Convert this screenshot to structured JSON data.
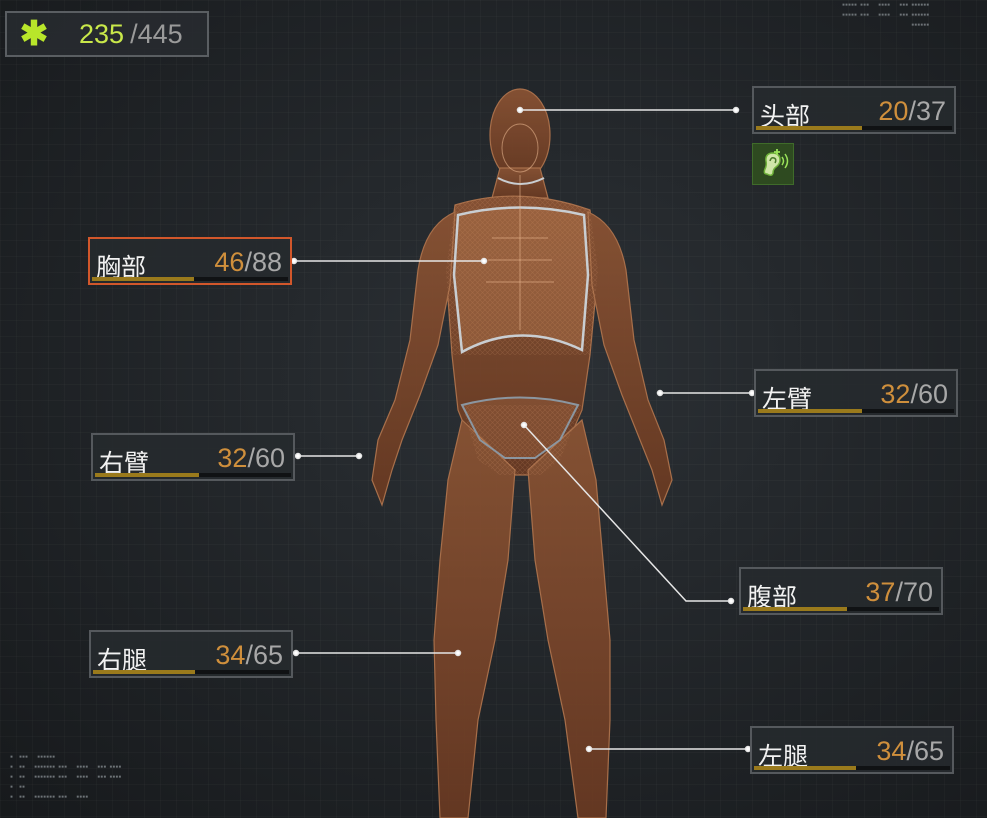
{
  "health_total": {
    "current": "235",
    "separator": " /",
    "max": "445",
    "icon": "medic-cross-icon",
    "accent": "#b8e62a"
  },
  "body_parts": [
    {
      "id": "head",
      "name": "头部",
      "current": "20",
      "max": "37",
      "fill": 0.54,
      "selected": false
    },
    {
      "id": "chest",
      "name": "胸部",
      "current": "46",
      "max": "88",
      "fill": 0.52,
      "selected": true
    },
    {
      "id": "left-arm",
      "name": "左臂",
      "current": "32",
      "max": "60",
      "fill": 0.53,
      "selected": false
    },
    {
      "id": "right-arm",
      "name": "右臂",
      "current": "32",
      "max": "60",
      "fill": 0.53,
      "selected": false
    },
    {
      "id": "stomach",
      "name": "腹部",
      "current": "37",
      "max": "70",
      "fill": 0.53,
      "selected": false
    },
    {
      "id": "right-leg",
      "name": "右腿",
      "current": "34",
      "max": "65",
      "fill": 0.52,
      "selected": false
    },
    {
      "id": "left-leg",
      "name": "左腿",
      "current": "34",
      "max": "65",
      "fill": 0.52,
      "selected": false
    }
  ],
  "head_status_icon": "hearing-ear-icon",
  "colors": {
    "value_current": "#cf8f3c",
    "value_max": "#a8a8a8",
    "selected_border": "#d2572b",
    "bar_fill": "#9a7a1c",
    "body": "#8a5030"
  }
}
